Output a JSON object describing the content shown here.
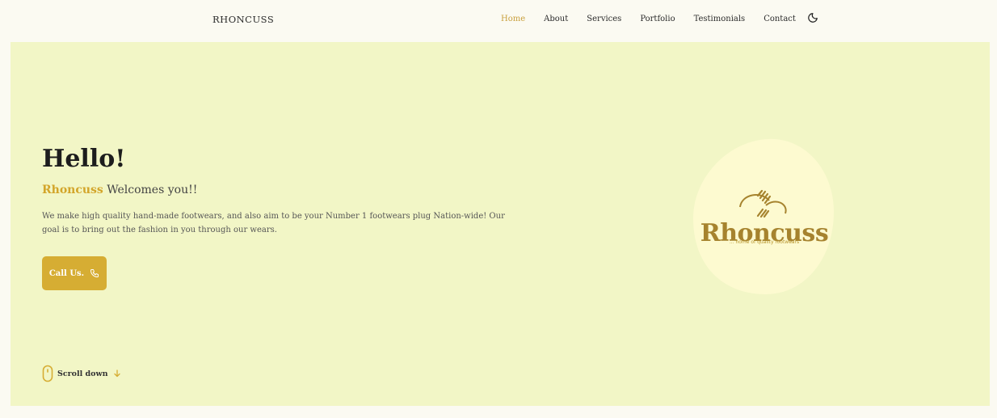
{
  "brand": "RHONCUSS",
  "nav": {
    "items": [
      "Home",
      "About",
      "Services",
      "Portfolio",
      "Testimonials",
      "Contact"
    ],
    "active": "Home",
    "theme_toggle_icon": "moon-icon"
  },
  "hero": {
    "title": "Hello!",
    "subtitle_highlight": "Rhoncuss",
    "subtitle_rest": "Welcomes you!!",
    "description": "We make high quality hand-made footwears, and also aim to be your Number 1 footwears plug Nation-wide! Our goal is to bring out the fashion in you through our wears.",
    "cta_label": "Call Us.",
    "cta_icon": "phone-icon",
    "scroll_label": "Scroll down",
    "scroll_icon": "mouse-icon",
    "scroll_arrow_icon": "arrow-down-icon"
  },
  "logo": {
    "wordmark": "Rhoncuss",
    "tagline": "... home of quality footwears"
  },
  "colors": {
    "accent": "#d6ad33",
    "hero_bg": "#f2f6c6",
    "page_bg": "#fbfaf2",
    "blob": "#fdfad0",
    "logo": "#a6832e"
  }
}
